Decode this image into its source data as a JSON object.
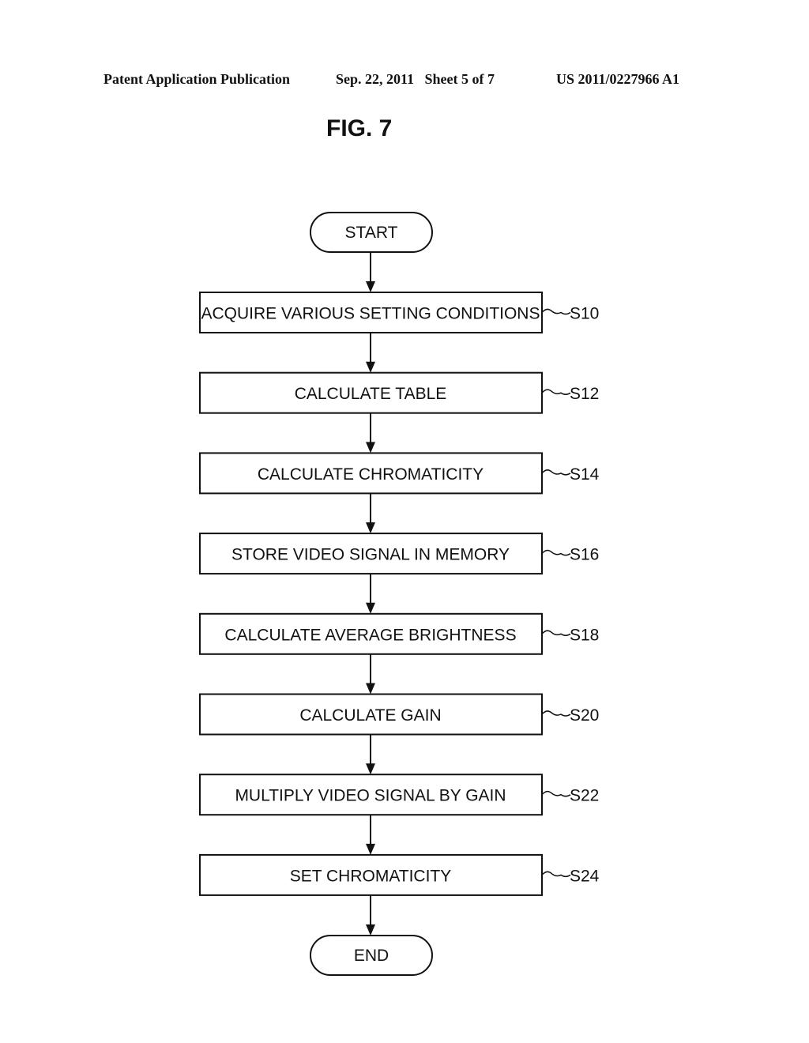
{
  "header": {
    "publication": "Patent Application Publication",
    "date_sheet": "Sep. 22, 2011   Sheet 5 of 7",
    "patent_number": "US 2011/0227966 A1"
  },
  "figure": {
    "title": "FIG. 7"
  },
  "flowchart": {
    "start": "START",
    "end": "END",
    "steps": [
      {
        "label": "ACQUIRE VARIOUS SETTING CONDITIONS",
        "id": "S10"
      },
      {
        "label": "CALCULATE TABLE",
        "id": "S12"
      },
      {
        "label": "CALCULATE CHROMATICITY",
        "id": "S14"
      },
      {
        "label": "STORE VIDEO SIGNAL IN MEMORY",
        "id": "S16"
      },
      {
        "label": "CALCULATE AVERAGE BRIGHTNESS",
        "id": "S18"
      },
      {
        "label": "CALCULATE GAIN",
        "id": "S20"
      },
      {
        "label": "MULTIPLY VIDEO SIGNAL BY GAIN",
        "id": "S22"
      },
      {
        "label": "SET CHROMATICITY",
        "id": "S24"
      }
    ]
  }
}
